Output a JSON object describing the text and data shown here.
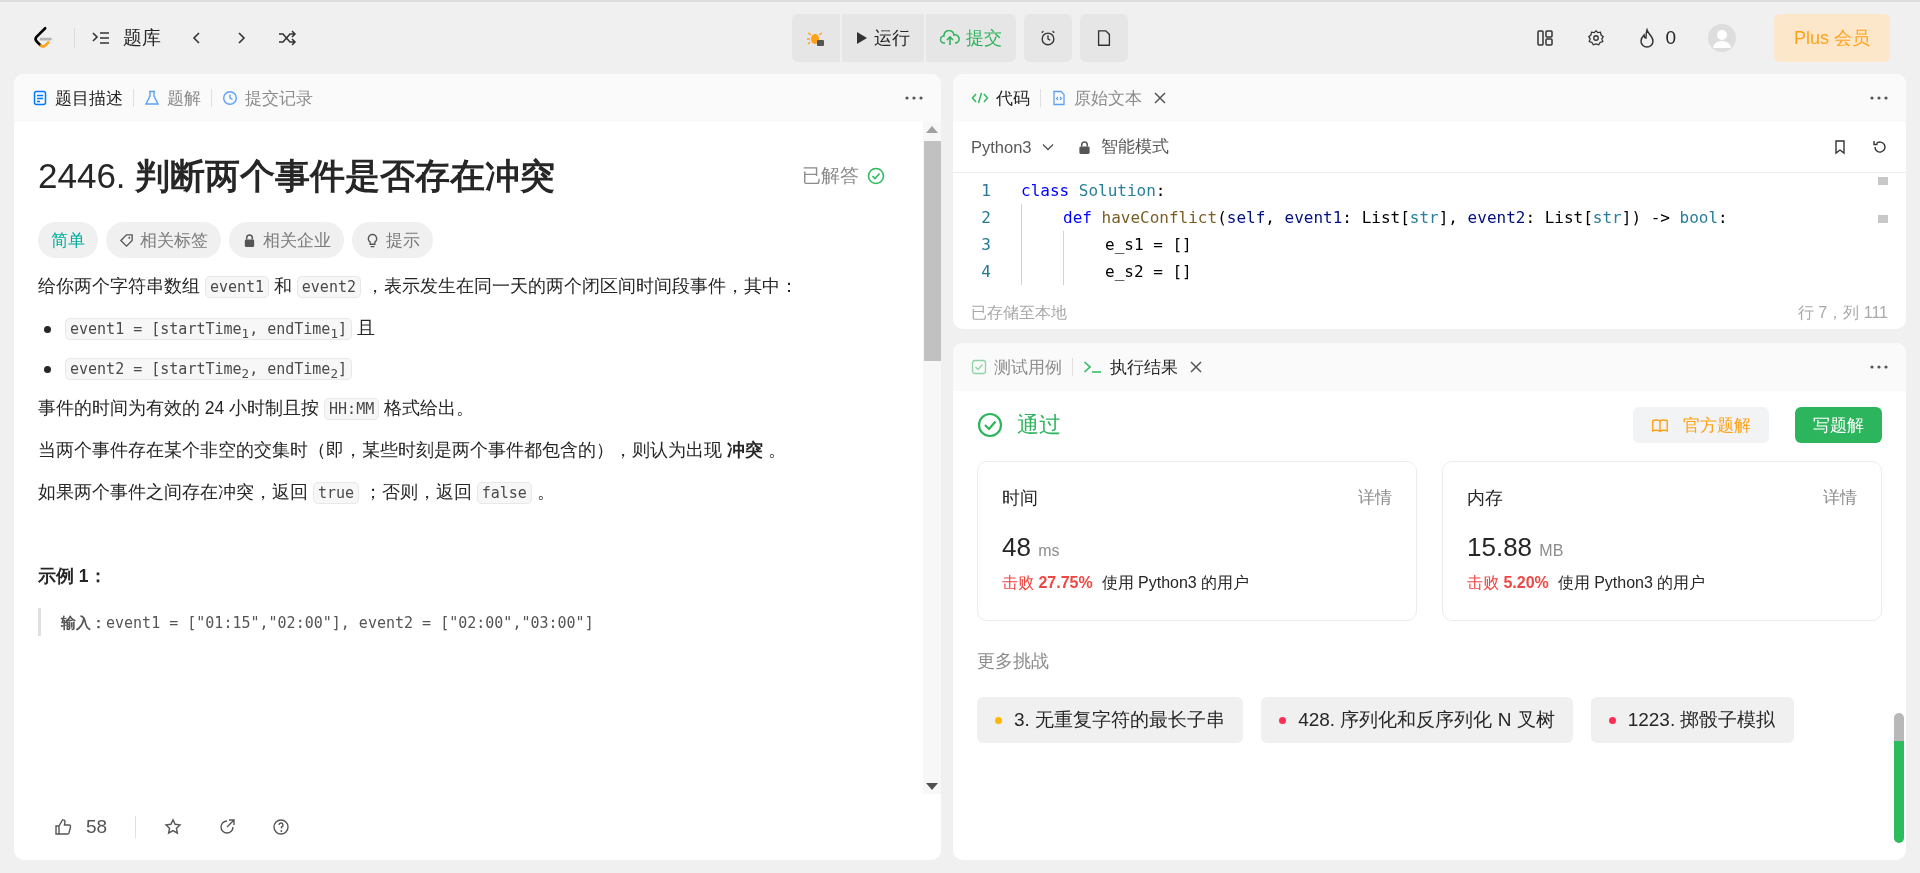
{
  "topbar": {
    "library": "题库",
    "run": "运行",
    "submit": "提交",
    "fire_count": "0",
    "plus": "Plus 会员"
  },
  "left_tabs": [
    {
      "label": "题目描述",
      "selected": true
    },
    {
      "label": "题解",
      "selected": false
    },
    {
      "label": "提交记录",
      "selected": false
    }
  ],
  "problem": {
    "title_number": "2446.",
    "title": "判断两个事件是否存在冲突",
    "status": "已解答",
    "tags": [
      {
        "label": "简单",
        "kind": "difficulty"
      },
      {
        "label": "相关标签",
        "kind": "tag"
      },
      {
        "label": "相关企业",
        "kind": "lock"
      },
      {
        "label": "提示",
        "kind": "hint"
      }
    ],
    "paragraphs": [
      {
        "kind": "text",
        "segments": [
          {
            "t": "给你两个字符串数组 ",
            "kind": "text"
          },
          {
            "t": "event1",
            "kind": "code"
          },
          {
            "t": " 和 ",
            "kind": "text"
          },
          {
            "t": "event2",
            "kind": "code"
          },
          {
            "t": " ，表示发生在同一天的两个闭区间时间段事件，其中：",
            "kind": "text"
          }
        ]
      },
      {
        "kind": "bullet",
        "segments": [
          {
            "t": "event1 = [startTime$_{1}$, endTime$_{1}$]",
            "kind": "code"
          },
          {
            "t": " 且",
            "kind": "text"
          }
        ]
      },
      {
        "kind": "bullet",
        "segments": [
          {
            "t": "event2 = [startTime$_{2}$, endTime$_{2}$]",
            "kind": "code"
          }
        ]
      },
      {
        "kind": "text",
        "segments": [
          {
            "t": "事件的时间为有效的 24 小时制且按 ",
            "kind": "text"
          },
          {
            "t": "HH:MM",
            "kind": "code"
          },
          {
            "t": " 格式给出。",
            "kind": "text"
          }
        ]
      },
      {
        "kind": "text",
        "segments": [
          {
            "t": "当两个事件存在某个非空的交集时（即，某些时刻是两个事件都包含的），则认为出现 **冲突** 。",
            "kind": "text"
          }
        ]
      },
      {
        "kind": "text",
        "segments": [
          {
            "t": "如果两个事件之间存在冲突，返回 ",
            "kind": "text"
          },
          {
            "t": "true",
            "kind": "code"
          },
          {
            "t": " ；否则，返回 ",
            "kind": "text"
          },
          {
            "t": "false",
            "kind": "code"
          },
          {
            "t": " 。",
            "kind": "text"
          }
        ]
      }
    ],
    "example_title": "示例 1：",
    "example_line": "**输入：**event1 = [\"01:15\",\"02:00\"], event2 = [\"02:00\",\"03:00\"]",
    "likes": "58"
  },
  "code_tabs": [
    {
      "label": "代码",
      "selected": true,
      "closable": false
    },
    {
      "label": "原始文本",
      "selected": false,
      "closable": true
    }
  ],
  "editor": {
    "language": "Python3",
    "mode": "智能模式",
    "saved": "已存储至本地",
    "cursor": "行 7，列 111",
    "lines": [
      {
        "n": "1",
        "tokens": [
          {
            "t": "class ",
            "kind": "keyword"
          },
          {
            "t": "Solution",
            "kind": "type"
          },
          {
            "t": ":",
            "kind": "plain"
          }
        ],
        "children": [
          {
            "n": "2",
            "tokens": [
              {
                "t": "def ",
                "kind": "keyword"
              },
              {
                "t": "haveConflict",
                "kind": "function"
              },
              {
                "t": "(",
                "kind": "plain"
              },
              {
                "t": "self",
                "kind": "variable"
              },
              {
                "t": ", ",
                "kind": "plain"
              },
              {
                "t": "event1",
                "kind": "variable"
              },
              {
                "t": ": List[",
                "kind": "plain"
              },
              {
                "t": "str",
                "kind": "type"
              },
              {
                "t": "], ",
                "kind": "plain"
              },
              {
                "t": "event2",
                "kind": "variable"
              },
              {
                "t": ": List[",
                "kind": "plain"
              },
              {
                "t": "str",
                "kind": "type"
              },
              {
                "t": "]) -> ",
                "kind": "plain"
              },
              {
                "t": "bool",
                "kind": "type"
              },
              {
                "t": ":",
                "kind": "plain"
              }
            ],
            "children": [
              {
                "n": "3",
                "tokens": [
                  {
                    "t": "e_s1 = []",
                    "kind": "plain"
                  }
                ]
              },
              {
                "n": "4",
                "tokens": [
                  {
                    "t": "e_s2 = []",
                    "kind": "plain"
                  }
                ]
              }
            ]
          }
        ]
      }
    ]
  },
  "result_tabs": [
    {
      "label": "测试用例",
      "selected": false,
      "closable": false
    },
    {
      "label": "执行结果",
      "selected": true,
      "closable": true
    }
  ],
  "result": {
    "status": "通过",
    "official": "官方题解",
    "write": "写题解",
    "stats": [
      {
        "label": "时间",
        "detail": "详情",
        "value": "48",
        "unit": "ms",
        "beat_label": "击败",
        "beat": "27.75%",
        "suffix": "使用 Python3 的用户"
      },
      {
        "label": "内存",
        "detail": "详情",
        "value": "15.88",
        "unit": "MB",
        "beat_label": "击败",
        "beat": "5.20%",
        "suffix": "使用 Python3 的用户"
      }
    ],
    "more": "更多挑战",
    "challenges": [
      {
        "label": "3. 无重复字符的最长子串",
        "color": "#ffb800"
      },
      {
        "label": "428. 序列化和反序列化 N 叉树",
        "color": "#ff2d55"
      },
      {
        "label": "1223. 掷骰子模拟",
        "color": "#ff2d55"
      }
    ]
  }
}
